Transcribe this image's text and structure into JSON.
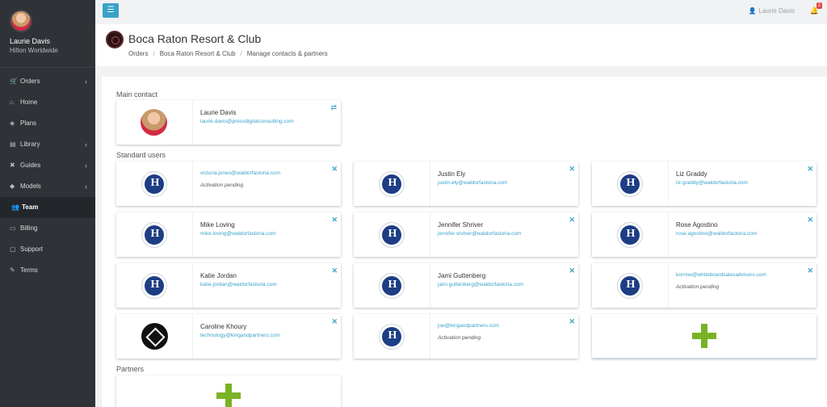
{
  "sidebar": {
    "user_name": "Laurie Davis",
    "user_org": "Hilton Worldwide",
    "items": [
      {
        "label": "Orders",
        "icon": "cart-icon",
        "has_submenu": true
      },
      {
        "label": "Home",
        "icon": "home-icon",
        "has_submenu": false
      },
      {
        "label": "Plans",
        "icon": "cube-icon",
        "has_submenu": false
      },
      {
        "label": "Library",
        "icon": "library-icon",
        "has_submenu": true
      },
      {
        "label": "Guides",
        "icon": "guides-icon",
        "has_submenu": true
      },
      {
        "label": "Models",
        "icon": "models-icon",
        "has_submenu": true
      },
      {
        "label": "Team",
        "icon": "team-icon",
        "has_submenu": false,
        "active": true
      },
      {
        "label": "Billing",
        "icon": "billing-icon",
        "has_submenu": false
      },
      {
        "label": "Support",
        "icon": "support-icon",
        "has_submenu": false
      },
      {
        "label": "Terms",
        "icon": "terms-icon",
        "has_submenu": false
      }
    ]
  },
  "topbar": {
    "user_label": "Laurie Davis",
    "notification_count": "2"
  },
  "header": {
    "title": "Boca Raton Resort & Club",
    "breadcrumb": [
      "Orders",
      "Boca Raton Resort & Club",
      "Manage contacts & partners"
    ]
  },
  "main_contact": {
    "label": "Main contact",
    "name": "Laurie Davis",
    "email": "laurie.davis@pressdigitalconsulting.com"
  },
  "standard_users": {
    "label": "Standard users",
    "users": [
      {
        "name": "",
        "email": "victoria.jones@waldorfastoria.com",
        "status": "Activation pending",
        "logo": "hilton"
      },
      {
        "name": "Justin Ely",
        "email": "justin.ely@waldorfastoria.com",
        "status": "",
        "logo": "hilton"
      },
      {
        "name": "Liz Graddy",
        "email": "liz.graddy@waldorfastoria.com",
        "status": "",
        "logo": "hilton"
      },
      {
        "name": "Mike Loving",
        "email": "mike.loving@waldorfastoria.com",
        "status": "",
        "logo": "hilton"
      },
      {
        "name": "Jennifer Shriver",
        "email": "jennifer.shriver@waldorfastoria.com",
        "status": "",
        "logo": "hilton"
      },
      {
        "name": "Rose Agostino",
        "email": "rose.agostino@waldorfastoria.com",
        "status": "",
        "logo": "hilton"
      },
      {
        "name": "Katie Jordan",
        "email": "katie.jordan@waldorfastoria.com",
        "status": "",
        "logo": "hilton"
      },
      {
        "name": "Jami Guttenberg",
        "email": "jami.guttenberg@waldorfastoria.com",
        "status": "",
        "logo": "hilton"
      },
      {
        "name": "",
        "email": "korrine@whiteboardsalesadvisors.com",
        "status": "Activation pending",
        "logo": "hilton"
      },
      {
        "name": "Caroline Khoury",
        "email": "technology@kingandpartners.com",
        "status": "",
        "logo": "kingandpartners"
      },
      {
        "name": "",
        "email": "joe@kingandpartners.com",
        "status": "Activation pending",
        "logo": "hilton"
      }
    ]
  },
  "partners": {
    "label": "Partners"
  },
  "colors": {
    "accent": "#3aa3c8",
    "add_green": "#7ab226",
    "sidebar_bg": "#2f3236"
  }
}
